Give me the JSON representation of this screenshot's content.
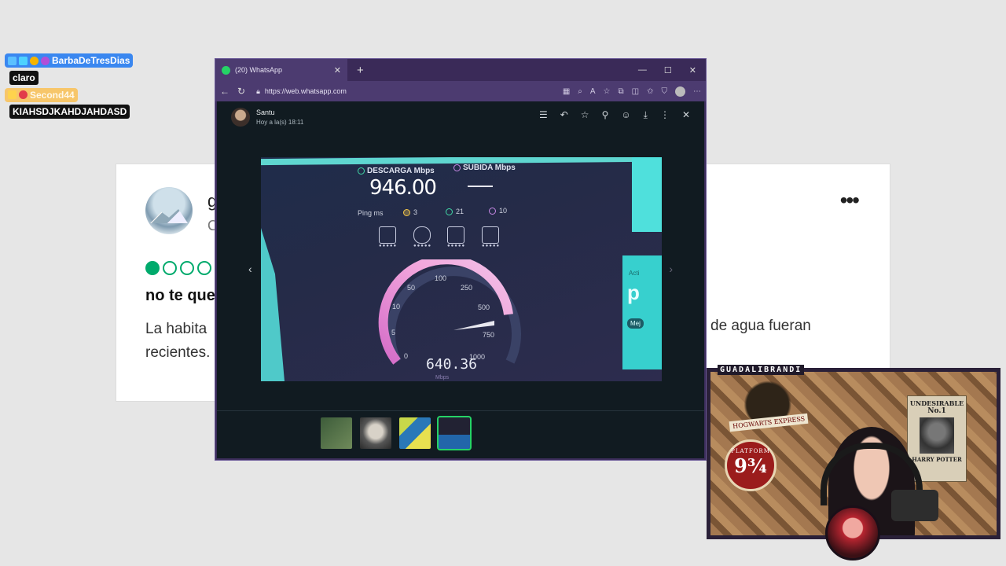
{
  "chat": {
    "user1": "BarbaDeTresDias",
    "msg1": "claro",
    "user2": "Second44",
    "msg2": "KIAHSDJKAHDJAHDASD"
  },
  "review_card": {
    "name": "g",
    "sub": "C",
    "title": "no te que",
    "body_left": "La habita recientes.",
    "body_right": "de agua fueran",
    "more": "•••",
    "rating_filled": 1,
    "rating_total": 5,
    "colors": {
      "rating": "#00aa6c"
    }
  },
  "browser": {
    "tab_title": "(20) WhatsApp",
    "url": "https://web.whatsapp.com"
  },
  "viewer": {
    "sender": "Santu",
    "time": "Hoy a la(s) 18:11",
    "prev_icon": "chevron-left-icon",
    "next_icon": "chevron-right-icon"
  },
  "speedtest": {
    "download_label": "DESCARGA Mbps",
    "upload_label": "SUBIDA Mbps",
    "download_value": "946.00",
    "ping_label": "Ping ms",
    "ping_idle": "3",
    "ping_down": "21",
    "ping_up": "10",
    "gauge_ticks": [
      "0",
      "5",
      "10",
      "50",
      "100",
      "250",
      "500",
      "750",
      "1000"
    ],
    "current_speed": "640.36",
    "unit": "Mbps",
    "promo_a": "Acti",
    "promo_b": "p",
    "promo_c": "Mej"
  },
  "stream": {
    "cam_label": "GUADALIBRANDI",
    "poster_line1": "UNDESIRABLE",
    "poster_line2": "No.1",
    "poster_line3": "HARRY POTTER",
    "platform_line1": "PLATFORM",
    "platform_line2": "9¾",
    "hogwarts_sign": "HOGWARTS EXPRESS"
  }
}
